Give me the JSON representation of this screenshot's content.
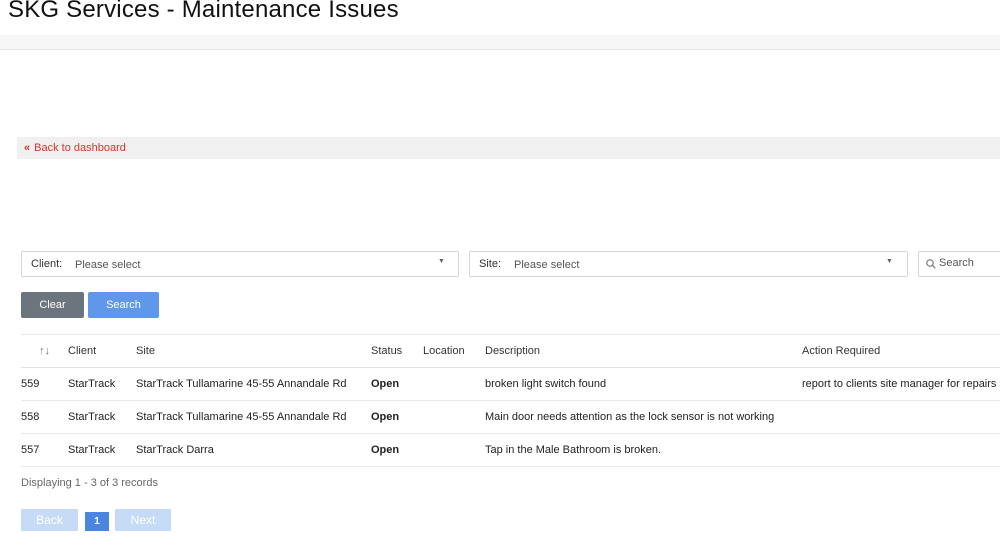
{
  "header": {
    "title": "SKG Services - Maintenance Issues"
  },
  "nav": {
    "back_label": "Back to dashboard",
    "back_icon": "double-chevron-left-icon"
  },
  "filters": {
    "client": {
      "label": "Client:",
      "value": "Please select"
    },
    "site": {
      "label": "Site:",
      "value": "Please select"
    },
    "search": {
      "placeholder": "Search",
      "icon": "search-icon"
    }
  },
  "actions": {
    "clear_label": "Clear",
    "search_label": "Search"
  },
  "table": {
    "sort_icon": "↑↓",
    "columns": [
      "Client",
      "Site",
      "Status",
      "Location",
      "Description",
      "Action Required"
    ],
    "rows": [
      {
        "id": "559",
        "client": "StarTrack",
        "site": "StarTrack Tullamarine 45-55 Annandale Rd",
        "status": "Open",
        "location": "",
        "description": "broken light switch found",
        "action": "report to clients site manager for repairs"
      },
      {
        "id": "558",
        "client": "StarTrack",
        "site": "StarTrack Tullamarine 45-55 Annandale Rd",
        "status": "Open",
        "location": "",
        "description": "Main door needs attention as the lock sensor is not working",
        "action": ""
      },
      {
        "id": "557",
        "client": "StarTrack",
        "site": "StarTrack Darra",
        "status": "Open",
        "location": "",
        "description": "Tap in the Male Bathroom is broken.",
        "action": ""
      }
    ]
  },
  "footer": {
    "records_info": "Displaying 1 - 3 of 3 records"
  },
  "pagination": {
    "back_label": "Back",
    "current_page": "1",
    "next_label": "Next"
  },
  "colors": {
    "accent": "#5f97e9",
    "status_open": "#f39c12",
    "link": "#d9342b"
  }
}
